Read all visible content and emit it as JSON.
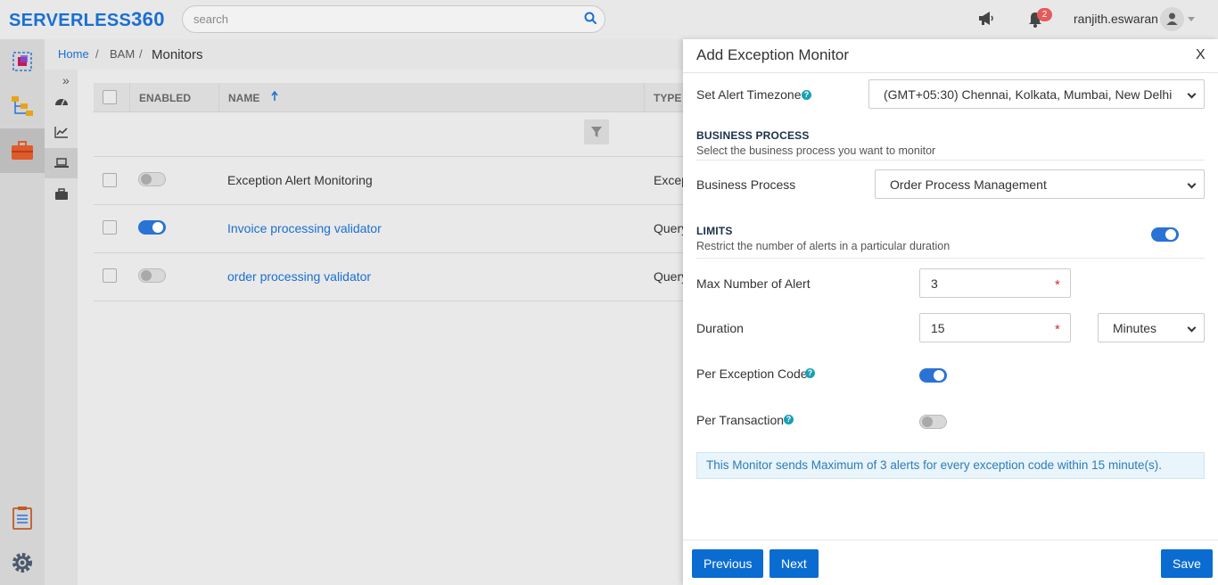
{
  "header": {
    "logo_text": "SERVERLESS",
    "logo_num": "360",
    "search_placeholder": "search",
    "notifications_count": "2",
    "username": "ranjith.eswaran"
  },
  "icons": {
    "search": "search-icon",
    "megaphone": "megaphone-icon",
    "bell": "bell-icon",
    "user": "user-icon"
  },
  "breadcrumb": {
    "home": "Home",
    "sep": "/",
    "bam": "BAM",
    "current": "Monitors"
  },
  "table": {
    "columns": {
      "enabled": "ENABLED",
      "name": "NAME",
      "type": "TYPE"
    },
    "rows": [
      {
        "enabled": false,
        "name": "Exception Alert Monitoring",
        "type": "Excep",
        "link": false
      },
      {
        "enabled": true,
        "name": "Invoice processing validator",
        "type": "Query",
        "link": true
      },
      {
        "enabled": false,
        "name": "order processing validator",
        "type": "Query",
        "link": true
      }
    ]
  },
  "panel": {
    "title": "Add Exception Monitor",
    "close": "X",
    "timezone_label": "Set Alert Timezone",
    "timezone_value": "(GMT+05:30) Chennai, Kolkata, Mumbai, New Delhi",
    "bp_heading": "BUSINESS PROCESS",
    "bp_desc": "Select the business process you want to monitor",
    "bp_label": "Business Process",
    "bp_value": "Order Process Management",
    "limits_heading": "LIMITS",
    "limits_desc": "Restrict the number of alerts in a particular duration",
    "limits_enabled": true,
    "max_alert_label": "Max Number of Alert",
    "max_alert_value": "3",
    "duration_label": "Duration",
    "duration_value": "15",
    "duration_unit": "Minutes",
    "per_exception_label": "Per Exception Code",
    "per_exception_enabled": true,
    "per_transaction_label": "Per Transaction",
    "per_transaction_enabled": false,
    "info_text": "This Monitor sends Maximum of 3 alerts for every exception code within 15 minute(s).",
    "required_mark": "*",
    "help_mark": "?",
    "buttons": {
      "previous": "Previous",
      "next": "Next",
      "save": "Save"
    }
  },
  "colors": {
    "brand_blue": "#1a6fd1",
    "button_blue": "#0a6cd1",
    "toggle_on": "#2a73d5",
    "help_teal": "#17a0b4",
    "badge_red": "#e45b5b",
    "info_bg": "#e9f4fb"
  }
}
